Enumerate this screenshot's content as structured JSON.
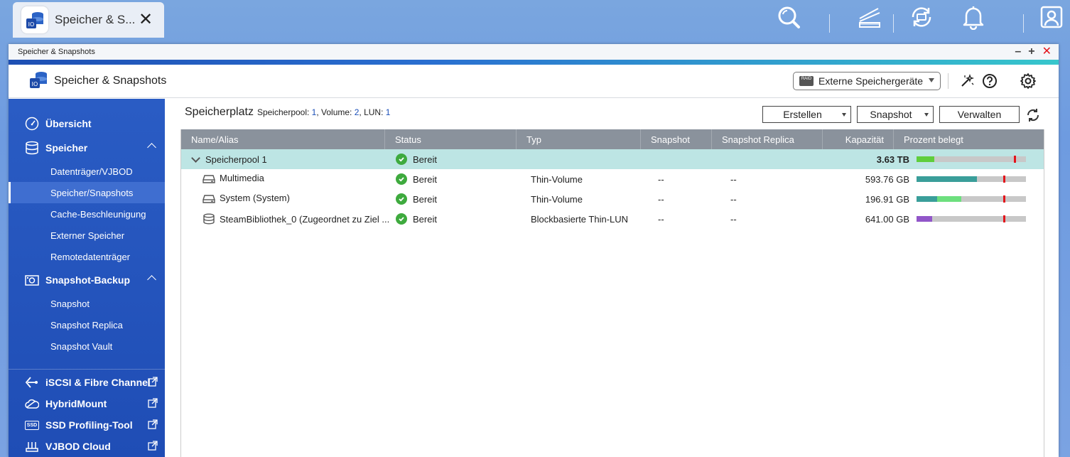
{
  "taskbar": {
    "tab_title": "Speicher & S...",
    "tab_close": "✕",
    "icons": [
      "search-icon",
      "dashboard-icon",
      "sync-icon",
      "bell-icon",
      "user-icon"
    ]
  },
  "window": {
    "title": "Speicher & Snapshots",
    "controls": {
      "minimize": "–",
      "maximize": "+",
      "close": "✕"
    }
  },
  "header": {
    "app_title": "Speicher & Snapshots",
    "external_button": "Externe Speichergeräte",
    "external_icon_text": "RAID"
  },
  "sidebar": {
    "uebersicht": "Übersicht",
    "speicher": "Speicher",
    "speicher_sub": [
      "Datenträger/VJBOD",
      "Speicher/Snapshots",
      "Cache-Beschleunigung",
      "Externer Speicher",
      "Remotedatenträger"
    ],
    "snapshot_backup": "Snapshot-Backup",
    "snapshot_sub": [
      "Snapshot",
      "Snapshot Replica",
      "Snapshot Vault"
    ],
    "iscsi": "iSCSI & Fibre Channel",
    "hybridmount": "HybridMount",
    "ssd": "SSD Profiling-Tool",
    "ssd_icon_text": "SSD",
    "vjbod": "VJBOD Cloud"
  },
  "content": {
    "title": "Speicherplatz",
    "summary": {
      "pool_label": "Speicherpool: ",
      "pool_count": "1",
      "volume_label": ", Volume: ",
      "volume_count": "2",
      "lun_label": ", LUN: ",
      "lun_count": "1"
    },
    "buttons": {
      "create": "Erstellen",
      "snapshot": "Snapshot",
      "manage": "Verwalten"
    },
    "columns": [
      "Name/Alias",
      "Status",
      "Typ",
      "Snapshot",
      "Snapshot Replica",
      "Kapazität",
      "Prozent belegt"
    ],
    "rows": [
      {
        "name": "Speicherpool 1",
        "status": "Bereit",
        "type": "",
        "snapshot": "",
        "replica": "",
        "capacity": "3.63 TB",
        "usage": {
          "segments": [
            {
              "pct": 16,
              "color": "#5fce3c"
            }
          ],
          "threshold_pct": 89
        }
      },
      {
        "name": "Multimedia",
        "status": "Bereit",
        "type": "Thin-Volume",
        "snapshot": "--",
        "replica": "--",
        "capacity": "593.76 GB",
        "usage": {
          "segments": [
            {
              "pct": 55,
              "color": "#3a9e9a"
            }
          ],
          "threshold_pct": 79
        }
      },
      {
        "name": "System (System)",
        "status": "Bereit",
        "type": "Thin-Volume",
        "snapshot": "--",
        "replica": "--",
        "capacity": "196.91 GB",
        "usage": {
          "segments": [
            {
              "pct": 19,
              "color": "#3a9e9a"
            },
            {
              "pct": 22,
              "color": "#6ddf7e"
            }
          ],
          "threshold_pct": 79
        }
      },
      {
        "name": "SteamBibliothek_0 (Zugeordnet zu Ziel ...",
        "status": "Bereit",
        "type": "Blockbasierte Thin-LUN",
        "snapshot": "--",
        "replica": "--",
        "capacity": "641.00 GB",
        "usage": {
          "segments": [
            {
              "pct": 14,
              "color": "#9156c9"
            }
          ],
          "threshold_pct": 79
        }
      }
    ]
  }
}
